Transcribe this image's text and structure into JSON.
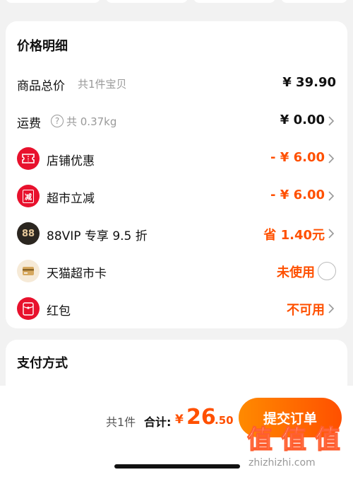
{
  "price_details": {
    "title": "价格明细",
    "rows": [
      {
        "label": "商品总价",
        "sub": "共1件宝贝",
        "value": "¥ 39.90"
      },
      {
        "label": "运费",
        "sub": "共 0.37kg",
        "help_glyph": "?",
        "value": "¥ 0.00"
      },
      {
        "label": "店铺优惠",
        "icon": "store-coupon-icon",
        "value": "- ¥ 6.00"
      },
      {
        "label": "超市立减",
        "icon": "supermarket-discount-icon",
        "icon_glyph": "减",
        "value": "- ¥ 6.00"
      },
      {
        "label": "88VIP 专享 9.5 折",
        "icon": "vip-88-icon",
        "icon_glyph": "88",
        "value": "省 1.40元"
      },
      {
        "label": "天猫超市卡",
        "icon": "tmall-card-icon",
        "value": "未使用"
      },
      {
        "label": "红包",
        "icon": "red-packet-icon",
        "value": "不可用"
      }
    ]
  },
  "payment": {
    "title": "支付方式"
  },
  "footer": {
    "count": "共1件",
    "total_label": "合计:",
    "currency": "¥",
    "total_int": "26",
    "total_dec": ".50",
    "submit_label": "提交订单"
  },
  "watermark": {
    "glyphs": [
      "值",
      "值",
      "值"
    ],
    "text": "zhizhizhi.com"
  },
  "colors": {
    "accent": "#ff5000",
    "red_icon": "#e8112d",
    "vip_dark": "#2b2620",
    "card_gold": "#e6c28a"
  }
}
